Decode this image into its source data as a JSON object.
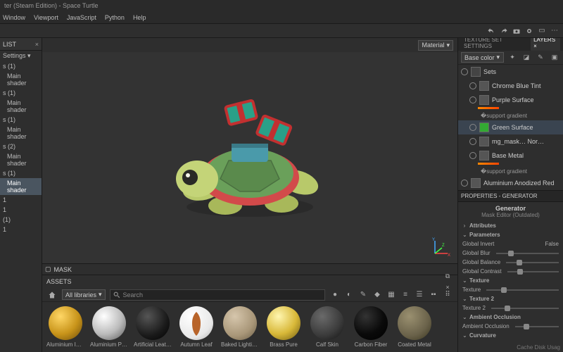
{
  "titlebar": "ter (Steam Edition) - Space Turtle",
  "menu": [
    "Window",
    "Viewport",
    "JavaScript",
    "Python",
    "Help"
  ],
  "leftPanel": {
    "title": "LIST",
    "settings": "Settings",
    "items": [
      {
        "label": "s (1)",
        "sub": "Main shader"
      },
      {
        "label": "s (1)",
        "sub": "Main shader"
      },
      {
        "label": "s (1)",
        "sub": "Main shader"
      },
      {
        "label": "s (2)",
        "sub": "Main shader"
      },
      {
        "label": "s (1)",
        "sub": "Main shader",
        "sel": true
      },
      {
        "label": "1",
        "sub": ""
      },
      {
        "label": "1",
        "sub": ""
      },
      {
        "label": "(1)",
        "sub": ""
      },
      {
        "label": "1",
        "sub": ""
      }
    ]
  },
  "viewportDropdowns": {
    "material": "Material",
    "baseColor": "Base color"
  },
  "maskLabel": "MASK",
  "assets": {
    "title": "ASSETS",
    "libs": "All libraries",
    "searchPlaceholder": "Search",
    "items": [
      {
        "label": "Aluminium Insulator",
        "bg": "radial-gradient(circle at 35% 30%, #ffd766, #c8941a 55%, #6a4a0a)"
      },
      {
        "label": "Aluminium Pure",
        "bg": "radial-gradient(circle at 35% 30%, #fff, #bbb 55%, #555)"
      },
      {
        "label": "Artificial Leather",
        "bg": "radial-gradient(circle at 35% 30%, #555, #1a1a1a 60%, #000)"
      },
      {
        "label": "Autumn Leaf",
        "bg": "radial-gradient(circle at 35% 30%, #fff, #e8e8e8 65%, #aaa)"
      },
      {
        "label": "Baked Lighting Mate",
        "bg": "radial-gradient(circle at 35% 30%, #d6c6ac, #a89678 60%, #665a44)"
      },
      {
        "label": "Brass Pure",
        "bg": "radial-gradient(circle at 35% 30%, #fff6b0, #d8b838 55%, #6a5610)"
      },
      {
        "label": "Calf Skin",
        "bg": "radial-gradient(circle at 35% 30%, #6a6a6a, #3a3a3a 60%, #111)"
      },
      {
        "label": "Carbon Fiber",
        "bg": "radial-gradient(circle at 35% 30%, #333, #0a0a0a 55%, #000)"
      },
      {
        "label": "Coated Metal",
        "bg": "radial-gradient(circle at 35% 30%, #9a9070, #6a624a 60%, #38341e)"
      }
    ]
  },
  "right": {
    "tab1": "TEXTURE SET SETTINGS",
    "tab2": "LAYERS",
    "layers": [
      {
        "name": "Sets",
        "type": "folder",
        "depth": 0
      },
      {
        "name": "Chrome Blue Tint",
        "type": "layer",
        "depth": 1
      },
      {
        "name": "Purple Surface",
        "type": "layer",
        "depth": 1,
        "grad": true
      },
      {
        "name": "Green Surface",
        "type": "layer",
        "depth": 1,
        "green": true,
        "sel": true
      },
      {
        "name": "mg_mask…    Nor…",
        "type": "sub",
        "depth": 2
      },
      {
        "name": "Base Metal",
        "type": "layer",
        "depth": 1,
        "grad": true
      },
      {
        "name": "Aluminium Anodized Red",
        "type": "layer",
        "depth": 0
      }
    ],
    "gradientLabel": "gradient",
    "propsTitle": "PROPERTIES - GENERATOR",
    "genLabel": "Generator",
    "maskEditor": "Mask Editor (Outdated)",
    "sections": [
      "Attributes",
      "Parameters",
      "Texture",
      "Texture 2",
      "Ambient Occlusion",
      "Curvature"
    ],
    "params": [
      {
        "k": "Global Invert",
        "v": "False"
      },
      {
        "k": "Global Blur",
        "slider": true
      },
      {
        "k": "Global Balance",
        "slider": true
      },
      {
        "k": "Global Contrast",
        "slider": true
      }
    ],
    "textureLabel": "Texture",
    "texture2Label": "Texture 2",
    "aoLabel": "Ambient Occlusion",
    "cacheLabel": "Cache Disk Usag"
  }
}
